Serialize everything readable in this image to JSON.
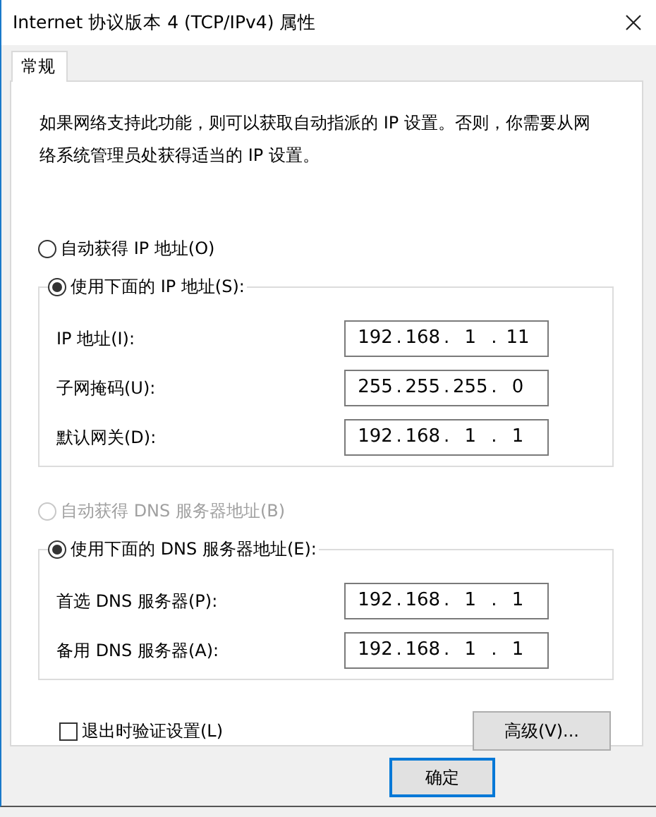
{
  "window": {
    "title": "Internet 协议版本 4 (TCP/IPv4) 属性"
  },
  "tabs": [
    {
      "label": "常规",
      "selected": true
    }
  ],
  "description": "如果网络支持此功能，则可以获取自动指派的 IP 设置。否则，你需要从网络系统管理员处获得适当的 IP 设置。",
  "ip_mode": [
    {
      "label": "自动获得 IP 地址(O)",
      "selected": false,
      "disabled": false
    },
    {
      "label": "使用下面的 IP 地址(S):",
      "selected": true,
      "disabled": false
    }
  ],
  "ip_fields": [
    {
      "label": "IP 地址(I):",
      "octets": [
        "192",
        "168",
        "1",
        "11"
      ]
    },
    {
      "label": "子网掩码(U):",
      "octets": [
        "255",
        "255",
        "255",
        "0"
      ]
    },
    {
      "label": "默认网关(D):",
      "octets": [
        "192",
        "168",
        "1",
        "1"
      ]
    }
  ],
  "dns_mode": [
    {
      "label": "自动获得 DNS 服务器地址(B)",
      "selected": false,
      "disabled": true
    },
    {
      "label": "使用下面的 DNS 服务器地址(E):",
      "selected": true,
      "disabled": false
    }
  ],
  "dns_fields": [
    {
      "label": "首选 DNS 服务器(P):",
      "octets": [
        "192",
        "168",
        "1",
        "1"
      ]
    },
    {
      "label": "备用 DNS 服务器(A):",
      "octets": [
        "192",
        "168",
        "1",
        "1"
      ]
    }
  ],
  "octet_separator": ".",
  "validate_on_exit": {
    "label": "退出时验证设置(L)",
    "checked": false
  },
  "buttons": [
    {
      "label": "高级(V)...",
      "kind": "advanced"
    },
    {
      "label": "确定",
      "kind": "default"
    }
  ]
}
